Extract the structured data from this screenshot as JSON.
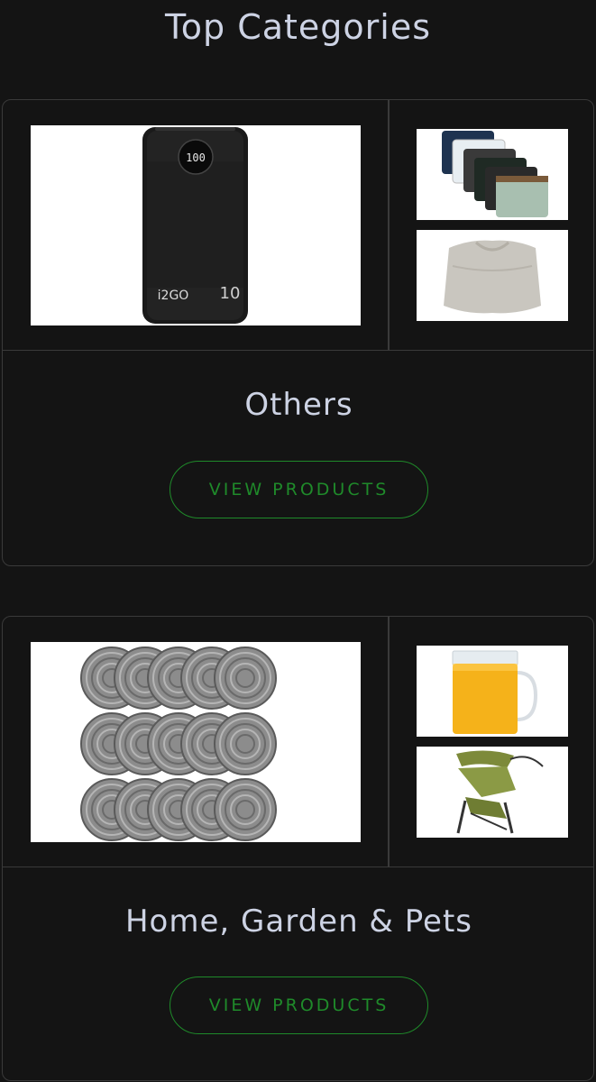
{
  "page": {
    "title": "Top Categories"
  },
  "categories": [
    {
      "name": "Others",
      "button_label": "VIEW PRODUCTS",
      "images": {
        "main": "power-bank-image",
        "side_top": "underwear-stack-image",
        "side_bottom": "folded-tshirt-image"
      },
      "power_bank_display": "100",
      "power_bank_brand": "i2GO",
      "power_bank_capacity": "10"
    },
    {
      "name": "Home, Garden & Pets",
      "button_label": "VIEW PRODUCTS",
      "images": {
        "main": "steel-scrubbers-image",
        "side_top": "juice-pitcher-image",
        "side_bottom": "camping-chair-image"
      }
    }
  ],
  "colors": {
    "background": "#141414",
    "border": "#3a3a3a",
    "button_accent": "#1f8a2a",
    "text": "#cdd3e4"
  }
}
